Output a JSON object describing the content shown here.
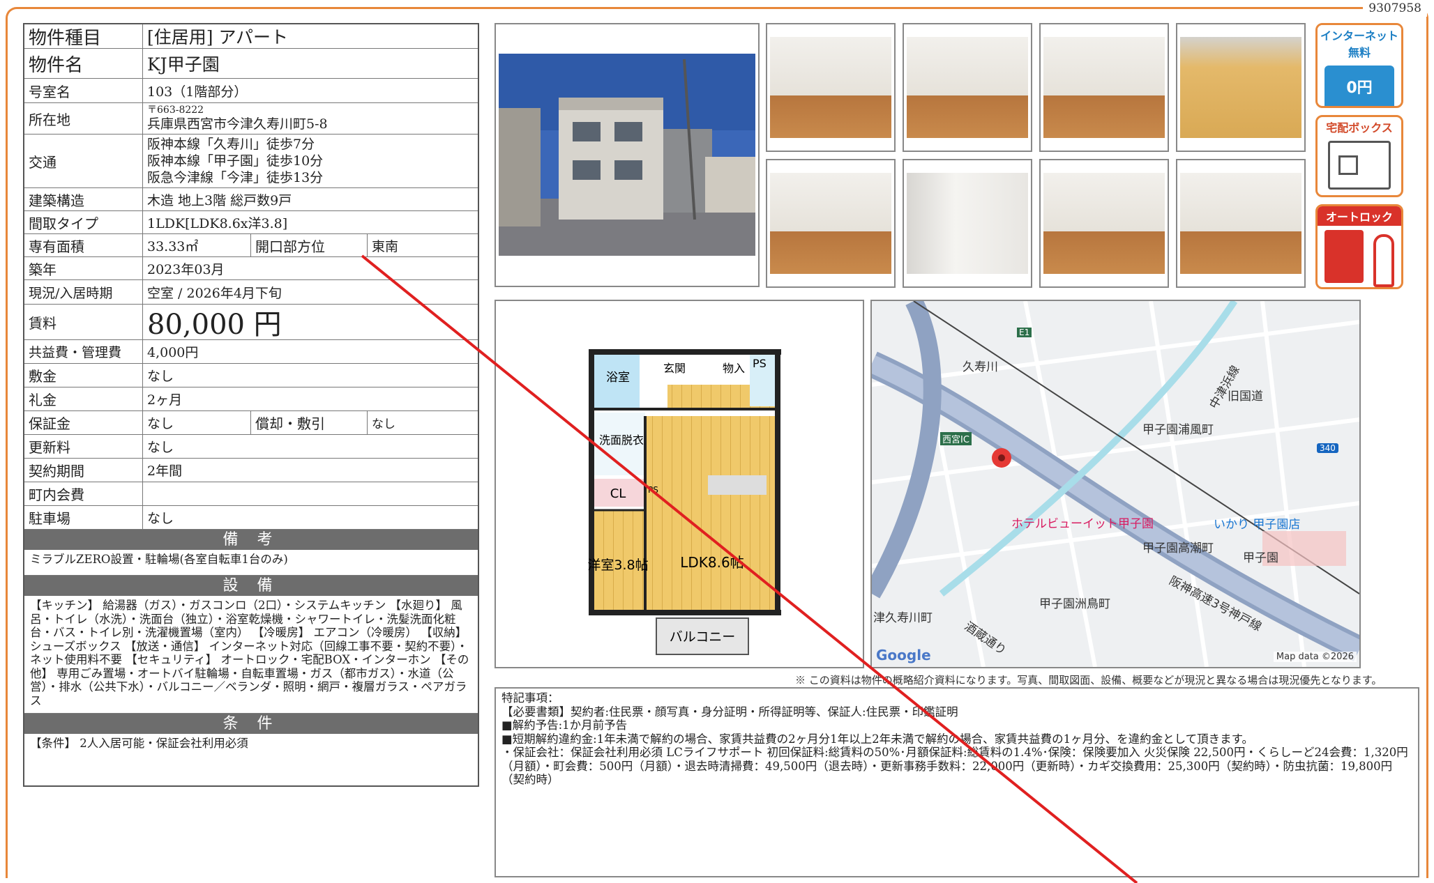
{
  "doc_id": "9307958",
  "info": {
    "type_label": "物件種目",
    "type_value": "[住居用] アパート",
    "name_label": "物件名",
    "name_value": "KJ甲子園",
    "room_label": "号室名",
    "room_value": "103（1階部分）",
    "address_label": "所在地",
    "address_zip": "〒663-8222",
    "address_value": "兵庫県西宮市今津久寿川町5-8",
    "transit_label": "交通",
    "transit_lines": [
      "阪神本線「久寿川」徒歩7分",
      "阪神本線「甲子園」徒歩10分",
      "阪急今津線「今津」徒歩13分"
    ],
    "structure_label": "建築構造",
    "structure_value": "木造 地上3階 総戸数9戸",
    "layout_label": "間取タイプ",
    "layout_value": "1LDK[LDK8.6x洋3.8]",
    "area_label": "専有面積",
    "area_value": "33.33㎡",
    "facing_label": "開口部方位",
    "facing_value": "東南",
    "built_label": "築年",
    "built_value": "2023年03月",
    "status_label": "現況/入居時期",
    "status_value": "空室 / 2026年4月下旬",
    "rent_label": "賃料",
    "rent_value": "80,000 円",
    "fee_label": "共益費・管理費",
    "fee_value": "4,000円",
    "deposit_label": "敷金",
    "deposit_value": "なし",
    "key_money_label": "礼金",
    "key_money_value": "2ヶ月",
    "guarantee_label": "保証金",
    "guarantee_value": "なし",
    "amort_label": "償却・敷引",
    "amort_value": "なし",
    "renewal_label": "更新料",
    "renewal_value": "なし",
    "term_label": "契約期間",
    "term_value": "2年間",
    "town_fee_label": "町内会費",
    "town_fee_value": "",
    "parking_label": "駐車場",
    "parking_value": "なし"
  },
  "remarks": {
    "title": "備 考",
    "text": "ミラブルZERO設置・駐輪場(各室自転車1台のみ)"
  },
  "equipment": {
    "title": "設 備",
    "text": "【キッチン】 給湯器（ガス）・ガスコンロ（2口）・システムキッチン 【水廻り】 風呂・トイレ（水洗）・洗面台（独立）・浴室乾燥機・シャワートイレ・洗髪洗面化粧台・バス・トイレ別・洗濯機置場（室内） 【冷暖房】 エアコン（冷暖房） 【収納】 シューズボックス 【放送・通信】 インターネット対応（回線工事不要・契約不要）・ネット使用料不要 【セキュリティ】 オートロック・宅配BOX・インターホン 【その他】 専用ごみ置場・オートバイ駐輪場・自転車置場・ガス（都市ガス）・水道（公営）・排水（公共下水）・バルコニー／ベランダ・照明・網戸・複層ガラス・ペアガラス"
  },
  "conditions": {
    "title": "条 件",
    "text": "【条件】 2人入居可能・保証会社利用必須"
  },
  "badges": {
    "internet": "インターネット無料",
    "internet_price": "0円",
    "delivery": "宅配ボックス",
    "autolock": "オートロック"
  },
  "floor_plan": {
    "bath": "浴室",
    "entrance": "玄関",
    "storage": "物入",
    "ps": "PS",
    "washroom": "洗面脱衣",
    "closet": "CL",
    "ps2": "PS",
    "western_room": "洋室3.8帖",
    "ldk": "LDK8.6帖",
    "balcony": "バルコニー"
  },
  "map": {
    "labels": [
      "久寿川",
      "旧国道",
      "甲子園浦風町",
      "西宮IC",
      "ホテルビューイット甲子園",
      "いかり 甲子園店",
      "甲子園高潮町",
      "甲子園",
      "阪神高速3号神戸線",
      "甲子園洲鳥町",
      "津久寿川町",
      "酒蔵通り",
      "中津浜線",
      "E1",
      "340"
    ],
    "google": "Google",
    "attribution": "Map data ©2026"
  },
  "disclaimer": "※ この資料は物件の概略紹介資料になります。写真、間取図面、設備、概要などが現況と異なる場合は現況優先となります。",
  "notes": {
    "title": "特記事項：",
    "lines": [
      "【必要書類】契約者:住民票・顔写真・身分証明・所得証明等、保証人:住民票・印鑑証明",
      "■解約予告:1か月前予告",
      "■短期解約違約金:1年未満で解約の場合、家賃共益費の2ヶ月分1年以上2年未満で解約の場合、家賃共益費の1ヶ月分、を違約金として頂きます。",
      "・保証会社：保証会社利用必須 LCライフサポート 初回保証料:総賃料の50%･月額保証料:総賃料の1.4%･保険：保険要加入 火災保険 22,500円・くらしーど24会費：1,320円（月額）・町会費：500円（月額）・退去時清掃費：49,500円（退去時）・更新事務手数料：22,000円（更新時）・カギ交換費用：25,300円（契約時）・防虫抗菌：19,800円（契約時）"
    ]
  },
  "colors": {
    "frame": "#e8873a",
    "section_bar": "#6d6d6d",
    "red_line": "#e02020",
    "floor_plan_wood": "#f0c96a"
  }
}
